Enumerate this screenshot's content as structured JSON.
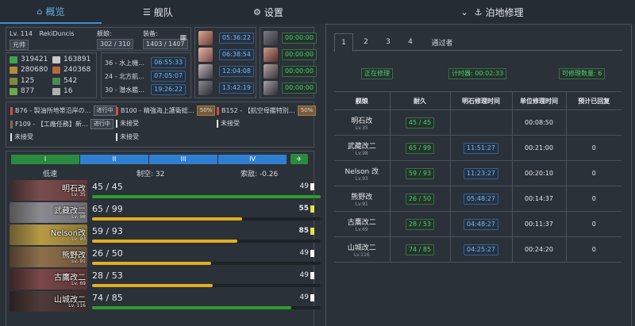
{
  "nav": {
    "tabs": [
      {
        "label": "概览",
        "icon": "home-icon"
      },
      {
        "label": "舰队",
        "icon": "list-icon"
      },
      {
        "label": "设置",
        "icon": "gear-icon"
      },
      {
        "label": "泊地修理",
        "icon": "anchor-icon"
      }
    ]
  },
  "admiral": {
    "level": "Lv. 114",
    "name": "RekiDuncis",
    "rank": "元帅",
    "ships_label": "舰娘:",
    "ships_value": "302 / 310",
    "equip_label": "装备:",
    "equip_value": "1403 / 1407"
  },
  "resources": [
    {
      "icon": "fuel-icon",
      "value": "319421",
      "color": "#3fa34d"
    },
    {
      "icon": "bauxite-icon",
      "value": "163891",
      "color": "#c9c9c9"
    },
    {
      "icon": "ammo-icon",
      "value": "280680",
      "color": "#b48a3c"
    },
    {
      "icon": "steel-icon",
      "value": "240368",
      "color": "#b9673c"
    },
    {
      "icon": "bucket-icon",
      "value": "125",
      "color": "#7f8a3e"
    },
    {
      "icon": "devmat-icon",
      "value": "542",
      "color": "#4a8b53"
    },
    {
      "icon": "screw-icon",
      "value": "877",
      "color": "#6da84a"
    },
    {
      "icon": "hammer-icon",
      "value": "16",
      "color": "#b1b1b1"
    }
  ],
  "expeditions": [
    {
      "label": "36 - 水上機…",
      "time": "06:55:33"
    },
    {
      "label": "24 - 北方航…",
      "time": "07:05:07"
    },
    {
      "label": "30 - 潜水艦…",
      "time": "19:26:22"
    }
  ],
  "repair_docks": [
    "05:36:22",
    "06:38:54",
    "12:04:08",
    "13:42:19"
  ],
  "construction_docks": [
    "00:00:00",
    "00:00:00",
    "00:00:00",
    "00:00:00"
  ],
  "quests": [
    {
      "label": "B76 - 製油所地帯沿岸の…",
      "tag": "进行中",
      "color": "#d84a4a"
    },
    {
      "label": "B100 - 精強海上護衛総…",
      "tag": "50%",
      "color": "#d84a4a"
    },
    {
      "label": "B152 - 【航空母艦特別…",
      "tag": "50%",
      "color": "#d84a4a"
    },
    {
      "label": "F109 - 【工廠任務】新…",
      "tag": "进行中",
      "color": "#8a6a4a"
    },
    {
      "label": "未接受",
      "tag": "",
      "color": "#e4e8ec"
    },
    {
      "label": "未接受",
      "tag": "",
      "color": "#e4e8ec"
    },
    {
      "label": "未接受",
      "tag": "",
      "color": "#e4e8ec"
    },
    {
      "label": "未接受",
      "tag": "",
      "color": "#e4e8ec"
    }
  ],
  "fleet": {
    "tabs": [
      "I",
      "II",
      "III",
      "IV"
    ],
    "speed": "低速",
    "air_label": "制空: 32",
    "los_label": "索敌: -0.26",
    "ships": [
      {
        "name": "明石改",
        "level": "Lv. 35",
        "hp": "45 / 45",
        "hp_frac": 1.0,
        "cond": "49",
        "color": "#2e9d2e",
        "cond_color": "#ffffff",
        "bg": "#7a4d4d"
      },
      {
        "name": "武藏改二",
        "level": "Lv. 98",
        "hp": "65 / 99",
        "hp_frac": 0.657,
        "cond": "55",
        "color": "#e3ae21",
        "cond_color": "#e8e04a",
        "bg": "#8a8a90"
      },
      {
        "name": "Nelson改",
        "level": "Lv. 93",
        "hp": "59 / 93",
        "hp_frac": 0.634,
        "cond": "85",
        "color": "#e3ae21",
        "cond_color": "#e8e04a",
        "bg": "#b79a45"
      },
      {
        "name": "熊野改",
        "level": "Lv. 91",
        "hp": "26 / 50",
        "hp_frac": 0.52,
        "cond": "49",
        "color": "#e3ae21",
        "cond_color": "#ffffff",
        "bg": "#8e6f4c"
      },
      {
        "name": "古鷹改二",
        "level": "Lv. 69",
        "hp": "28 / 53",
        "hp_frac": 0.528,
        "cond": "49",
        "color": "#e3ae21",
        "cond_color": "#ffffff",
        "bg": "#7a4848"
      },
      {
        "name": "山城改二",
        "level": "Lv. 116",
        "hp": "74 / 85",
        "hp_frac": 0.871,
        "cond": "49",
        "color": "#2e9d2e",
        "cond_color": "#ffffff",
        "bg": "#4f3a3a"
      }
    ]
  },
  "repair": {
    "tabs": [
      "1",
      "2",
      "3",
      "4",
      "通过者"
    ],
    "status": "正在修理",
    "timer_label": "计时器: 00:02:33",
    "count_label": "可修理数量: 6",
    "headers": [
      "舰娘",
      "耐久",
      "明石修理时间",
      "单位修理时间",
      "预计已回复"
    ],
    "rows": [
      {
        "name": "明石改",
        "level": "Lv.35",
        "hp": "45 / 45",
        "akashi": "",
        "unit": "00:08:50",
        "recovered": ""
      },
      {
        "name": "武藏改二",
        "level": "Lv.98",
        "hp": "65 / 99",
        "akashi": "11:51:27",
        "unit": "00:21:00",
        "recovered": "0"
      },
      {
        "name": "Nelson 改",
        "level": "Lv.93",
        "hp": "59 / 93",
        "akashi": "11:23:27",
        "unit": "00:20:10",
        "recovered": "0"
      },
      {
        "name": "熊野改",
        "level": "Lv.91",
        "hp": "26 / 50",
        "akashi": "05:48:27",
        "unit": "00:14:37",
        "recovered": "0"
      },
      {
        "name": "古鷹改二",
        "level": "Lv.69",
        "hp": "28 / 53",
        "akashi": "04:48:27",
        "unit": "00:11:37",
        "recovered": "0"
      },
      {
        "name": "山城改二",
        "level": "Lv.116",
        "hp": "74 / 85",
        "akashi": "04:25:27",
        "unit": "00:24:20",
        "recovered": "0"
      }
    ]
  }
}
